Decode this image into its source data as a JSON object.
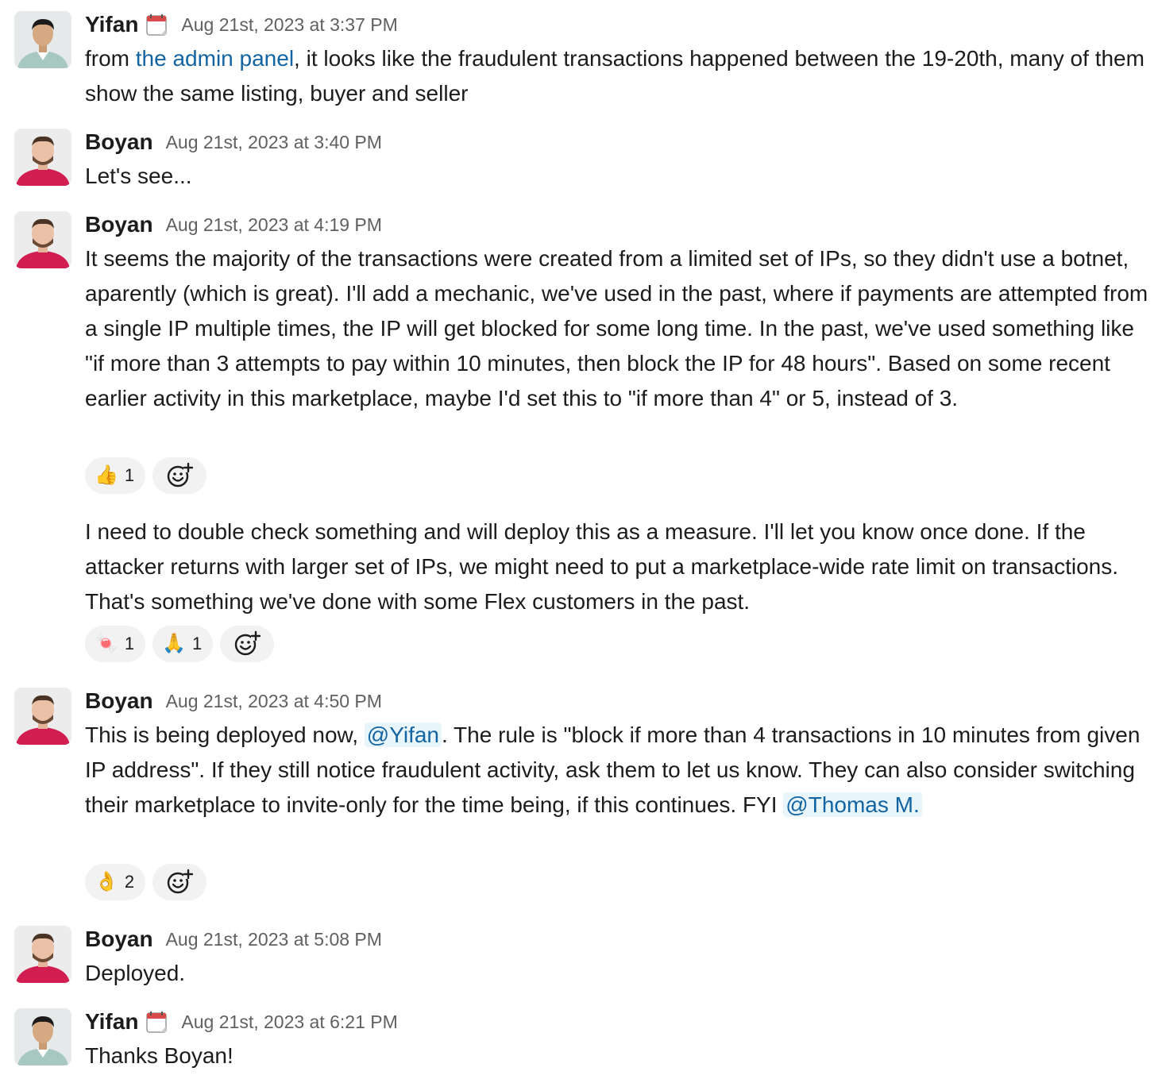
{
  "messages": [
    {
      "author": "Yifan",
      "time": "Aug 21st, 2023 at 3:37 PM",
      "text_prefix": "from ",
      "link_text": "the admin panel",
      "text_suffix": ", it looks like the fraudulent transactions happened between the 19-20th, many of them show the same listing, buyer and seller"
    },
    {
      "author": "Boyan",
      "time": "Aug 21st, 2023 at 3:40 PM",
      "text": "Let's see..."
    },
    {
      "author": "Boyan",
      "time": "Aug 21st, 2023 at 4:19 PM",
      "text": "It seems the majority of the transactions were created from a limited set of IPs, so they didn't use a botnet, aparently (which is great). I'll add a mechanic, we've used in the past, where if payments are attempted from a single IP multiple times, the IP will get blocked for some long time. In the past, we've used something like \"if more than 3 attempts to pay within 10 minutes, then block the IP for 48 hours\". Based on some recent earlier activity in this marketplace, maybe I'd set this to \"if more than 4\" or 5, instead of 3.",
      "reactions": [
        {
          "emoji": "👍",
          "name": "thumbs-up",
          "count": "1"
        }
      ],
      "followup": {
        "text": "I need to double check something and will deploy this as a measure. I'll let you know once done. If the attacker returns with larger set of IPs, we might need to put a marketplace-wide rate limit on transactions. That's something we've done with some Flex customers in the past.",
        "reactions": [
          {
            "emoji": "🍬",
            "name": "candy",
            "count": "1"
          },
          {
            "emoji": "🙏",
            "name": "folded-hands",
            "count": "1"
          }
        ]
      }
    },
    {
      "author": "Boyan",
      "time": "Aug 21st, 2023 at 4:50 PM",
      "text_1": "This is being deployed now, ",
      "mention_1": "@Yifan",
      "text_2": ". The rule is \"block if more than 4 transactions in 10 minutes from given IP address\". If they still notice fraudulent activity, ask them to let us know. They can also consider switching their marketplace to invite-only for the time being, if this continues. FYI ",
      "mention_2": "@Thomas M.",
      "reactions": [
        {
          "emoji": "👌",
          "name": "ok-hand",
          "count": "2"
        }
      ]
    },
    {
      "author": "Boyan",
      "time": "Aug 21st, 2023 at 5:08 PM",
      "text": "Deployed."
    },
    {
      "author": "Yifan",
      "time": "Aug 21st, 2023 at 6:21 PM",
      "text": "Thanks Boyan!"
    }
  ],
  "colors": {
    "link": "#1264a3",
    "mention_bg": "#e8f5fa",
    "reaction_bg": "#f2f2f2",
    "timestamp": "#616061",
    "boyan_shirt": "#d11d4f",
    "yifan_shirt": "#a6c8c0"
  }
}
